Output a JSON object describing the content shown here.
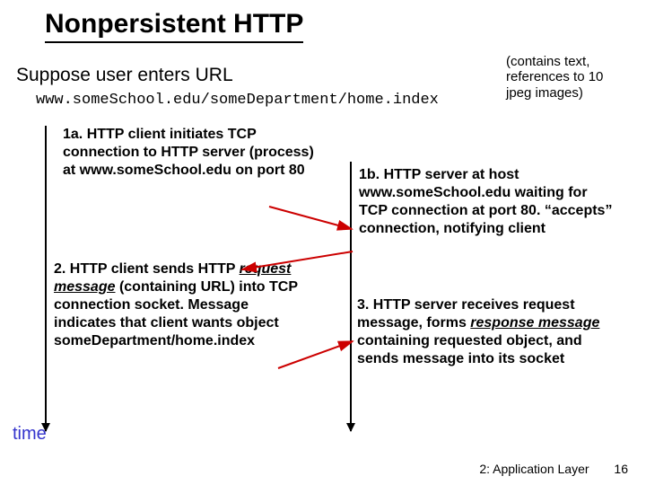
{
  "title": "Nonpersistent HTTP",
  "suppose": "Suppose user enters URL",
  "url": "www.someSchool.edu/someDepartment/home.index",
  "sidenote": "(contains text, references to 10 jpeg images)",
  "steps": {
    "s1a": {
      "lead": "1a.",
      "boldrest": " HTTP client initiates TCP connection to HTTP server (process) at www.someSchool.edu on port 80",
      "plain": ""
    },
    "s1b": {
      "lead": "1b.",
      "boldrest": " HTTP server at host www.someSchool.edu waiting for TCP connection at port 80. “accepts” connection, notifying client",
      "plain": ""
    },
    "s2": {
      "lead": "2.",
      "boldrest": " HTTP client sends HTTP ",
      "ulitalic": "request message",
      "plain": " (containing URL) into TCP connection socket. Message indicates that client wants object someDepartment/home.index"
    },
    "s3": {
      "lead": "3.",
      "boldrest": " HTTP server receives request message, forms ",
      "ulitalic": "response message",
      "plain": " containing requested object, and sends message into its socket"
    }
  },
  "timelabel": "time",
  "footer": {
    "chapter": "2: Application Layer",
    "page": "16"
  }
}
